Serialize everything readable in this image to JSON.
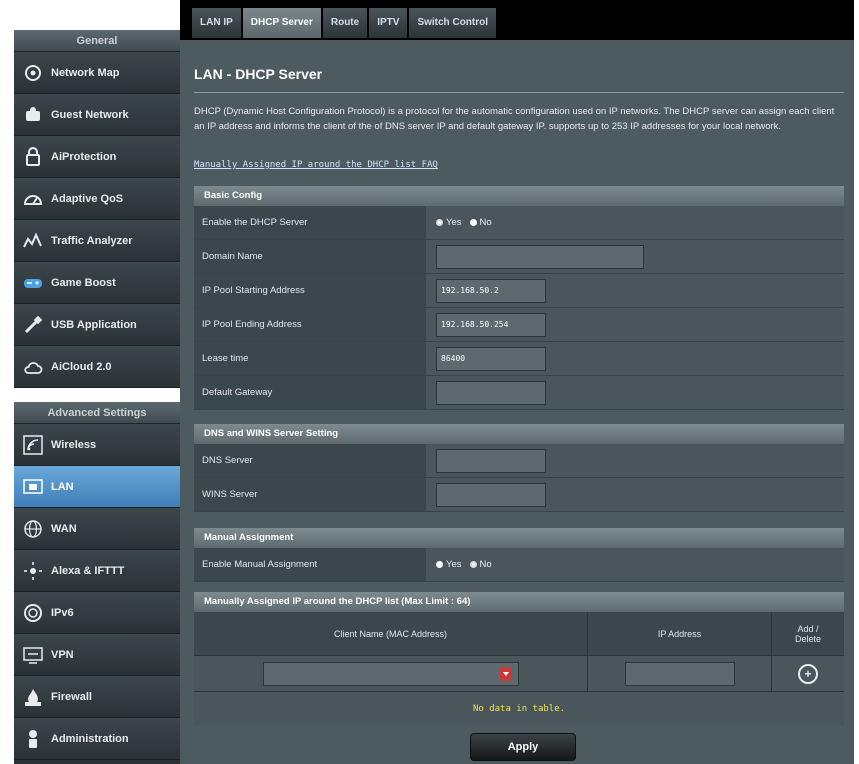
{
  "tabs": [
    "LAN IP",
    "DHCP Server",
    "Route",
    "IPTV",
    "Switch Control"
  ],
  "sidebar": {
    "general_header": "General",
    "general_items": [
      {
        "label": "Network Map",
        "icon": "network-map-icon"
      },
      {
        "label": "Guest Network",
        "icon": "guest-network-icon"
      },
      {
        "label": "AiProtection",
        "icon": "lock-icon"
      },
      {
        "label": "Adaptive QoS",
        "icon": "gauge-icon"
      },
      {
        "label": "Traffic Analyzer",
        "icon": "traffic-chart-icon"
      },
      {
        "label": "Game Boost",
        "icon": "gamepad-icon"
      },
      {
        "label": "USB Application",
        "icon": "usb-icon"
      },
      {
        "label": "AiCloud 2.0",
        "icon": "cloud-icon"
      }
    ],
    "advanced_header": "Advanced Settings",
    "advanced_items": [
      {
        "label": "Wireless",
        "icon": "wifi-icon"
      },
      {
        "label": "LAN",
        "icon": "lan-icon",
        "active": true
      },
      {
        "label": "WAN",
        "icon": "globe-icon"
      },
      {
        "label": "Alexa & IFTTT",
        "icon": "alexa-icon"
      },
      {
        "label": "IPv6",
        "icon": "ipv6-icon"
      },
      {
        "label": "VPN",
        "icon": "vpn-icon"
      },
      {
        "label": "Firewall",
        "icon": "firewall-icon"
      },
      {
        "label": "Administration",
        "icon": "admin-icon"
      }
    ]
  },
  "main": {
    "title": "LAN - DHCP Server",
    "description": "DHCP (Dynamic Host Configuration Protocol) is a protocol for the automatic configuration used on IP networks. The DHCP server can assign each client an IP address and informs the client of the of DNS server IP and default gateway IP. supports up to 253 IP addresses for your local network.",
    "faq_link": "Manually Assigned IP around the DHCP list FAQ",
    "basic_config": {
      "header": "Basic Config",
      "enable_label": "Enable the DHCP Server",
      "yes": "Yes",
      "no": "No",
      "domain_label": "Domain Name",
      "domain_value": "",
      "start_label": "IP Pool Starting Address",
      "start_value": "192.168.50.2",
      "end_label": "IP Pool Ending Address",
      "end_value": "192.168.50.254",
      "lease_label": "Lease time",
      "lease_value": "86400",
      "gateway_label": "Default Gateway",
      "gateway_value": ""
    },
    "dns_wins": {
      "header": "DNS and WINS Server Setting",
      "dns_label": "DNS Server",
      "dns_value": "",
      "wins_label": "WINS Server",
      "wins_value": ""
    },
    "manual": {
      "header": "Manual Assignment",
      "enable_label": "Enable Manual Assignment",
      "yes": "Yes",
      "no": "No"
    },
    "manual_list": {
      "header": "Manually Assigned IP around the DHCP list (Max Limit : 64)",
      "col_client": "Client Name (MAC Address)",
      "col_ip": "IP Address",
      "col_add": "Add / Delete",
      "no_data": "No data in table."
    },
    "apply_label": "Apply"
  }
}
